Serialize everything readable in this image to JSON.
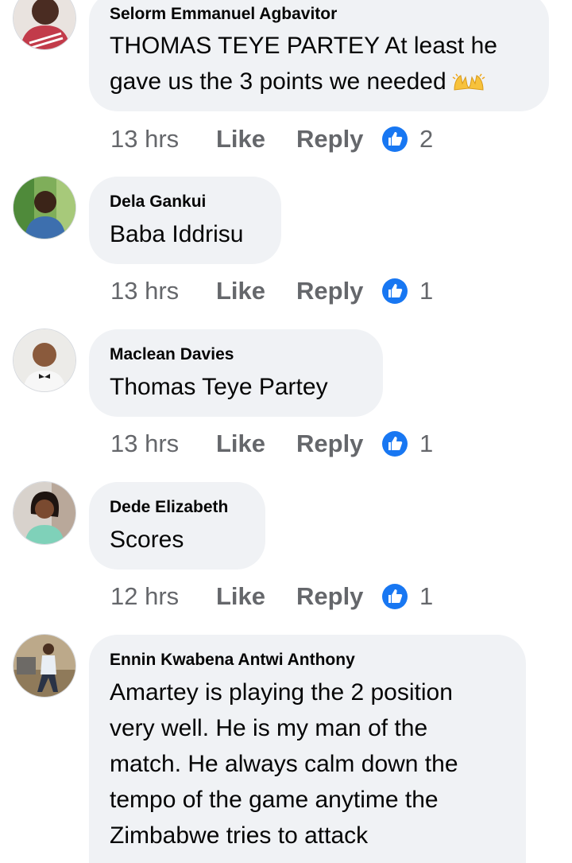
{
  "actions": {
    "like_label": "Like",
    "reply_label": "Reply"
  },
  "colors": {
    "bubble": "#f0f2f5",
    "text": "#050505",
    "meta": "#65676b",
    "like_blue": "#1877f2"
  },
  "comments": [
    {
      "author": "Selorm Emmanuel Agbavitor",
      "lines": [
        "THOMAS TEYE PARTEY At least he",
        "gave us the 3 points we needed"
      ],
      "emoji": "raising-hands-emoji",
      "time": "13 hrs",
      "reactions": "2"
    },
    {
      "author": "Dela Gankui",
      "lines": [
        "Baba Iddrisu"
      ],
      "time": "13 hrs",
      "reactions": "1"
    },
    {
      "author": "Maclean Davies",
      "lines": [
        "Thomas Teye Partey"
      ],
      "time": "13 hrs",
      "reactions": "1"
    },
    {
      "author": "Dede Elizabeth",
      "lines": [
        "Scores"
      ],
      "time": "12 hrs",
      "reactions": "1"
    },
    {
      "author": "Ennin Kwabena Antwi Anthony",
      "lines": [
        "Amartey is playing the 2 position",
        "very well. He is my man of the",
        "match. He always calm down the",
        "tempo of the game anytime the",
        "Zimbabwe tries to attack"
      ]
    }
  ]
}
